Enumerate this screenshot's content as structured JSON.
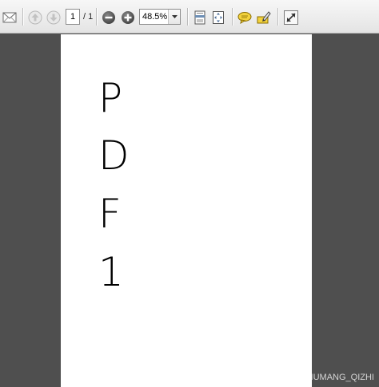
{
  "toolbar": {
    "page_current": "1",
    "page_total": "/ 1",
    "zoom_value": "48.5%",
    "icons": [
      "mail-icon",
      "previous-page-icon",
      "next-page-icon",
      "zoom-out-icon",
      "zoom-in-icon",
      "fit-width-icon",
      "fit-page-icon",
      "comment-icon",
      "highlight-icon",
      "expand-icon"
    ]
  },
  "document": {
    "letters": [
      "P",
      "D",
      "F",
      "1"
    ]
  },
  "watermark": "https://blog.csdn.net/BADAO_LIUMANG_QIZHI",
  "colors": {
    "viewer_background": "#4f4f4f",
    "page_background": "#ffffff",
    "toolbar_background": "#eeeeee"
  }
}
